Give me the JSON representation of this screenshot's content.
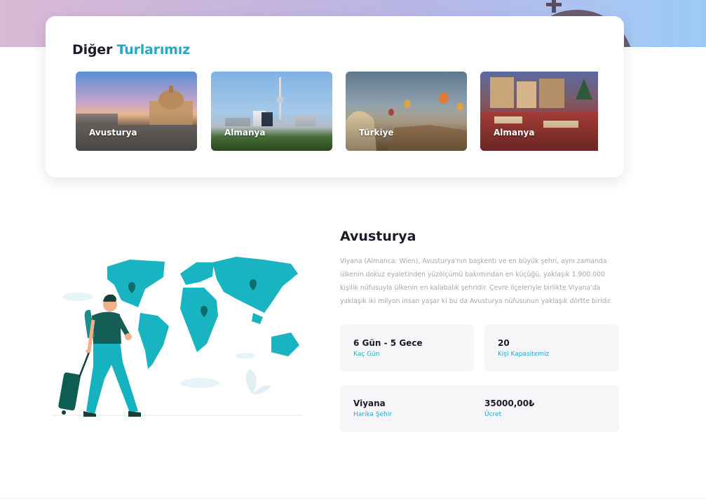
{
  "colors": {
    "accent": "#27a8c2",
    "card_bg": "#f6f6f8",
    "text": "#1c1c28",
    "muted": "#a6a6b0"
  },
  "section": {
    "title_prefix": "Diğer",
    "title_accent": "Turlarımız"
  },
  "tours": [
    {
      "label": "Avusturya"
    },
    {
      "label": "Almanya"
    },
    {
      "label": "Türkiye"
    },
    {
      "label": "Almanya"
    }
  ],
  "detail": {
    "title": "Avusturya",
    "description": "Viyana (Almanca: Wien), Avusturya'nın başkenti ve en büyük şehri, aynı zamanda ülkenin dokuz eyaletinden yüzölçümü bakımından en küçüğü, yaklaşık 1.900.000 kişilik nüfusuyla ülkenin en kalabalık şehridir. Çevre ilçeleriyle birlikte Viyana'da yaklaşık iki milyon insan yaşar ki bu da Avusturya nüfusunun yaklaşık dörtte biridir.",
    "duration": {
      "value": "6 Gün - 5 Gece",
      "label": "Kaç Gün"
    },
    "capacity": {
      "value": "20",
      "label": "Kişi Kapasitemiz"
    },
    "city": {
      "value": "Viyana",
      "label": "Harika Şehir"
    },
    "price": {
      "value": "35000,00₺",
      "label": "Ücret"
    }
  }
}
